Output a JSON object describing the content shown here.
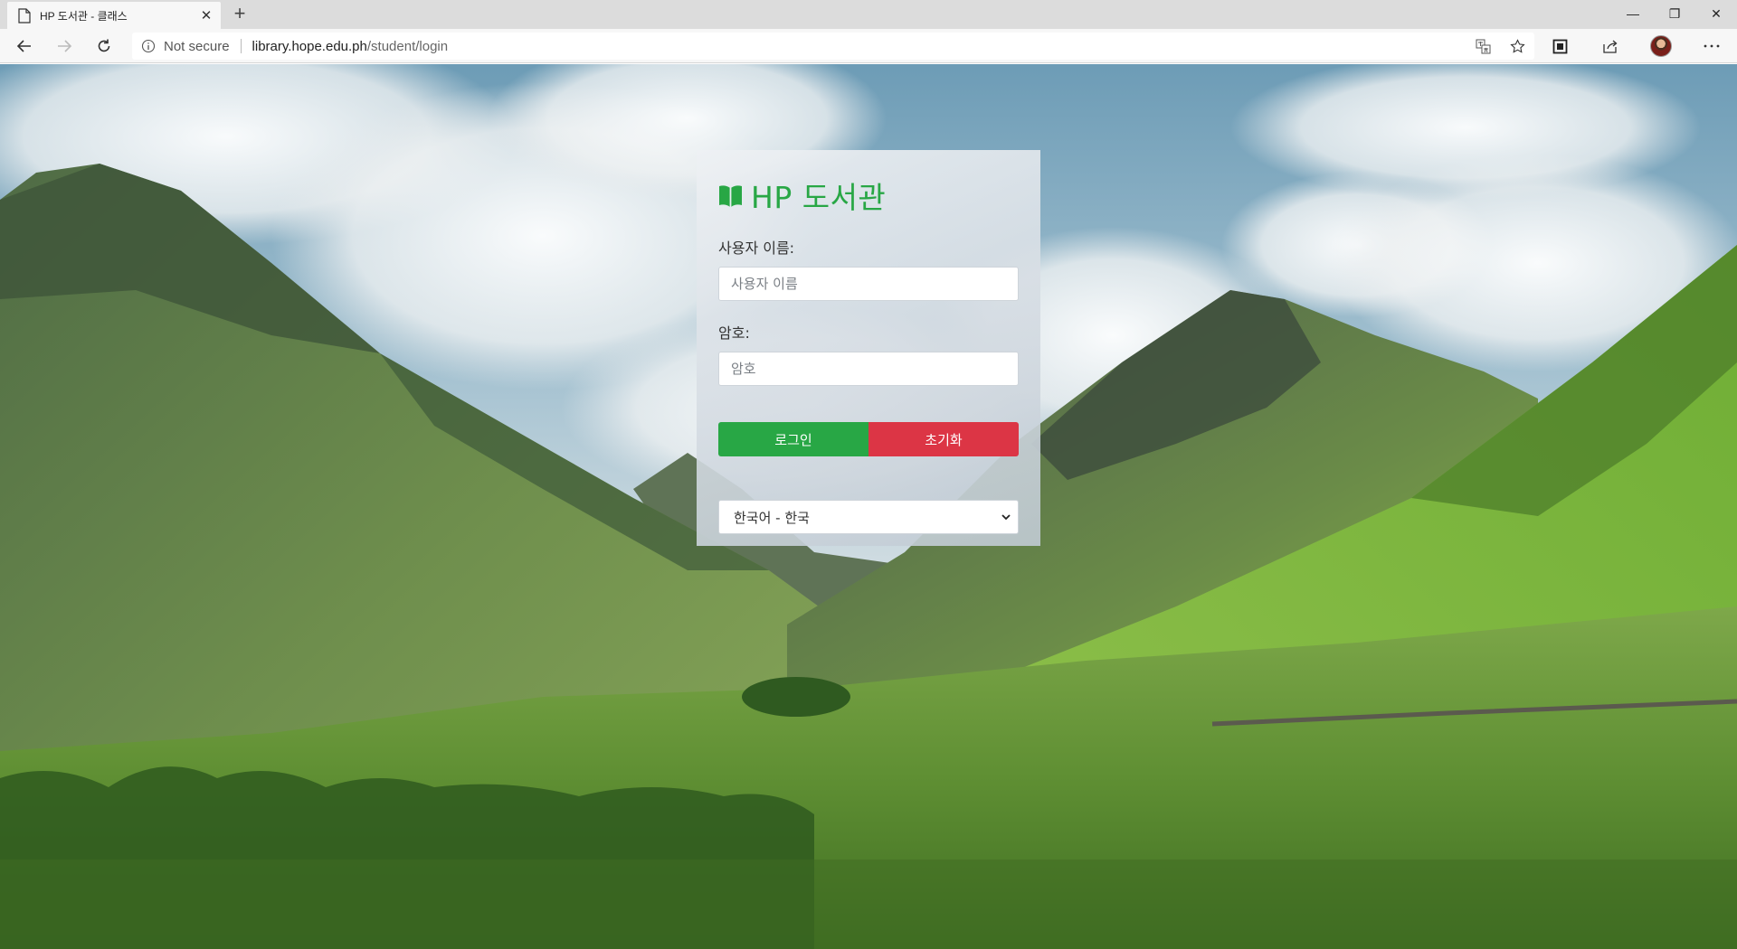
{
  "browser": {
    "tab_title": "HP 도서관 - 클래스",
    "tab_close": "✕",
    "new_tab": "+",
    "window": {
      "minimize": "—",
      "maximize": "❐",
      "close": "✕"
    },
    "address": {
      "security_text": "Not secure",
      "host": "library.hope.edu.ph",
      "path": "/student/login"
    },
    "icons": [
      "back-icon",
      "forward-icon",
      "refresh-icon",
      "info-icon",
      "translate-icon",
      "favorite-star-icon",
      "reading-view-icon",
      "share-icon",
      "profile-avatar",
      "more-icon"
    ]
  },
  "login": {
    "brand_title": "HP 도서관",
    "brand_color": "#28a745",
    "username_label": "사용자 이름:",
    "username_placeholder": "사용자 이름",
    "password_label": "암호:",
    "password_placeholder": "암호",
    "login_button": "로그인",
    "reset_button": "초기화",
    "login_color": "#28a745",
    "reset_color": "#dc3545",
    "language_selected": "한국어 - 한국"
  }
}
